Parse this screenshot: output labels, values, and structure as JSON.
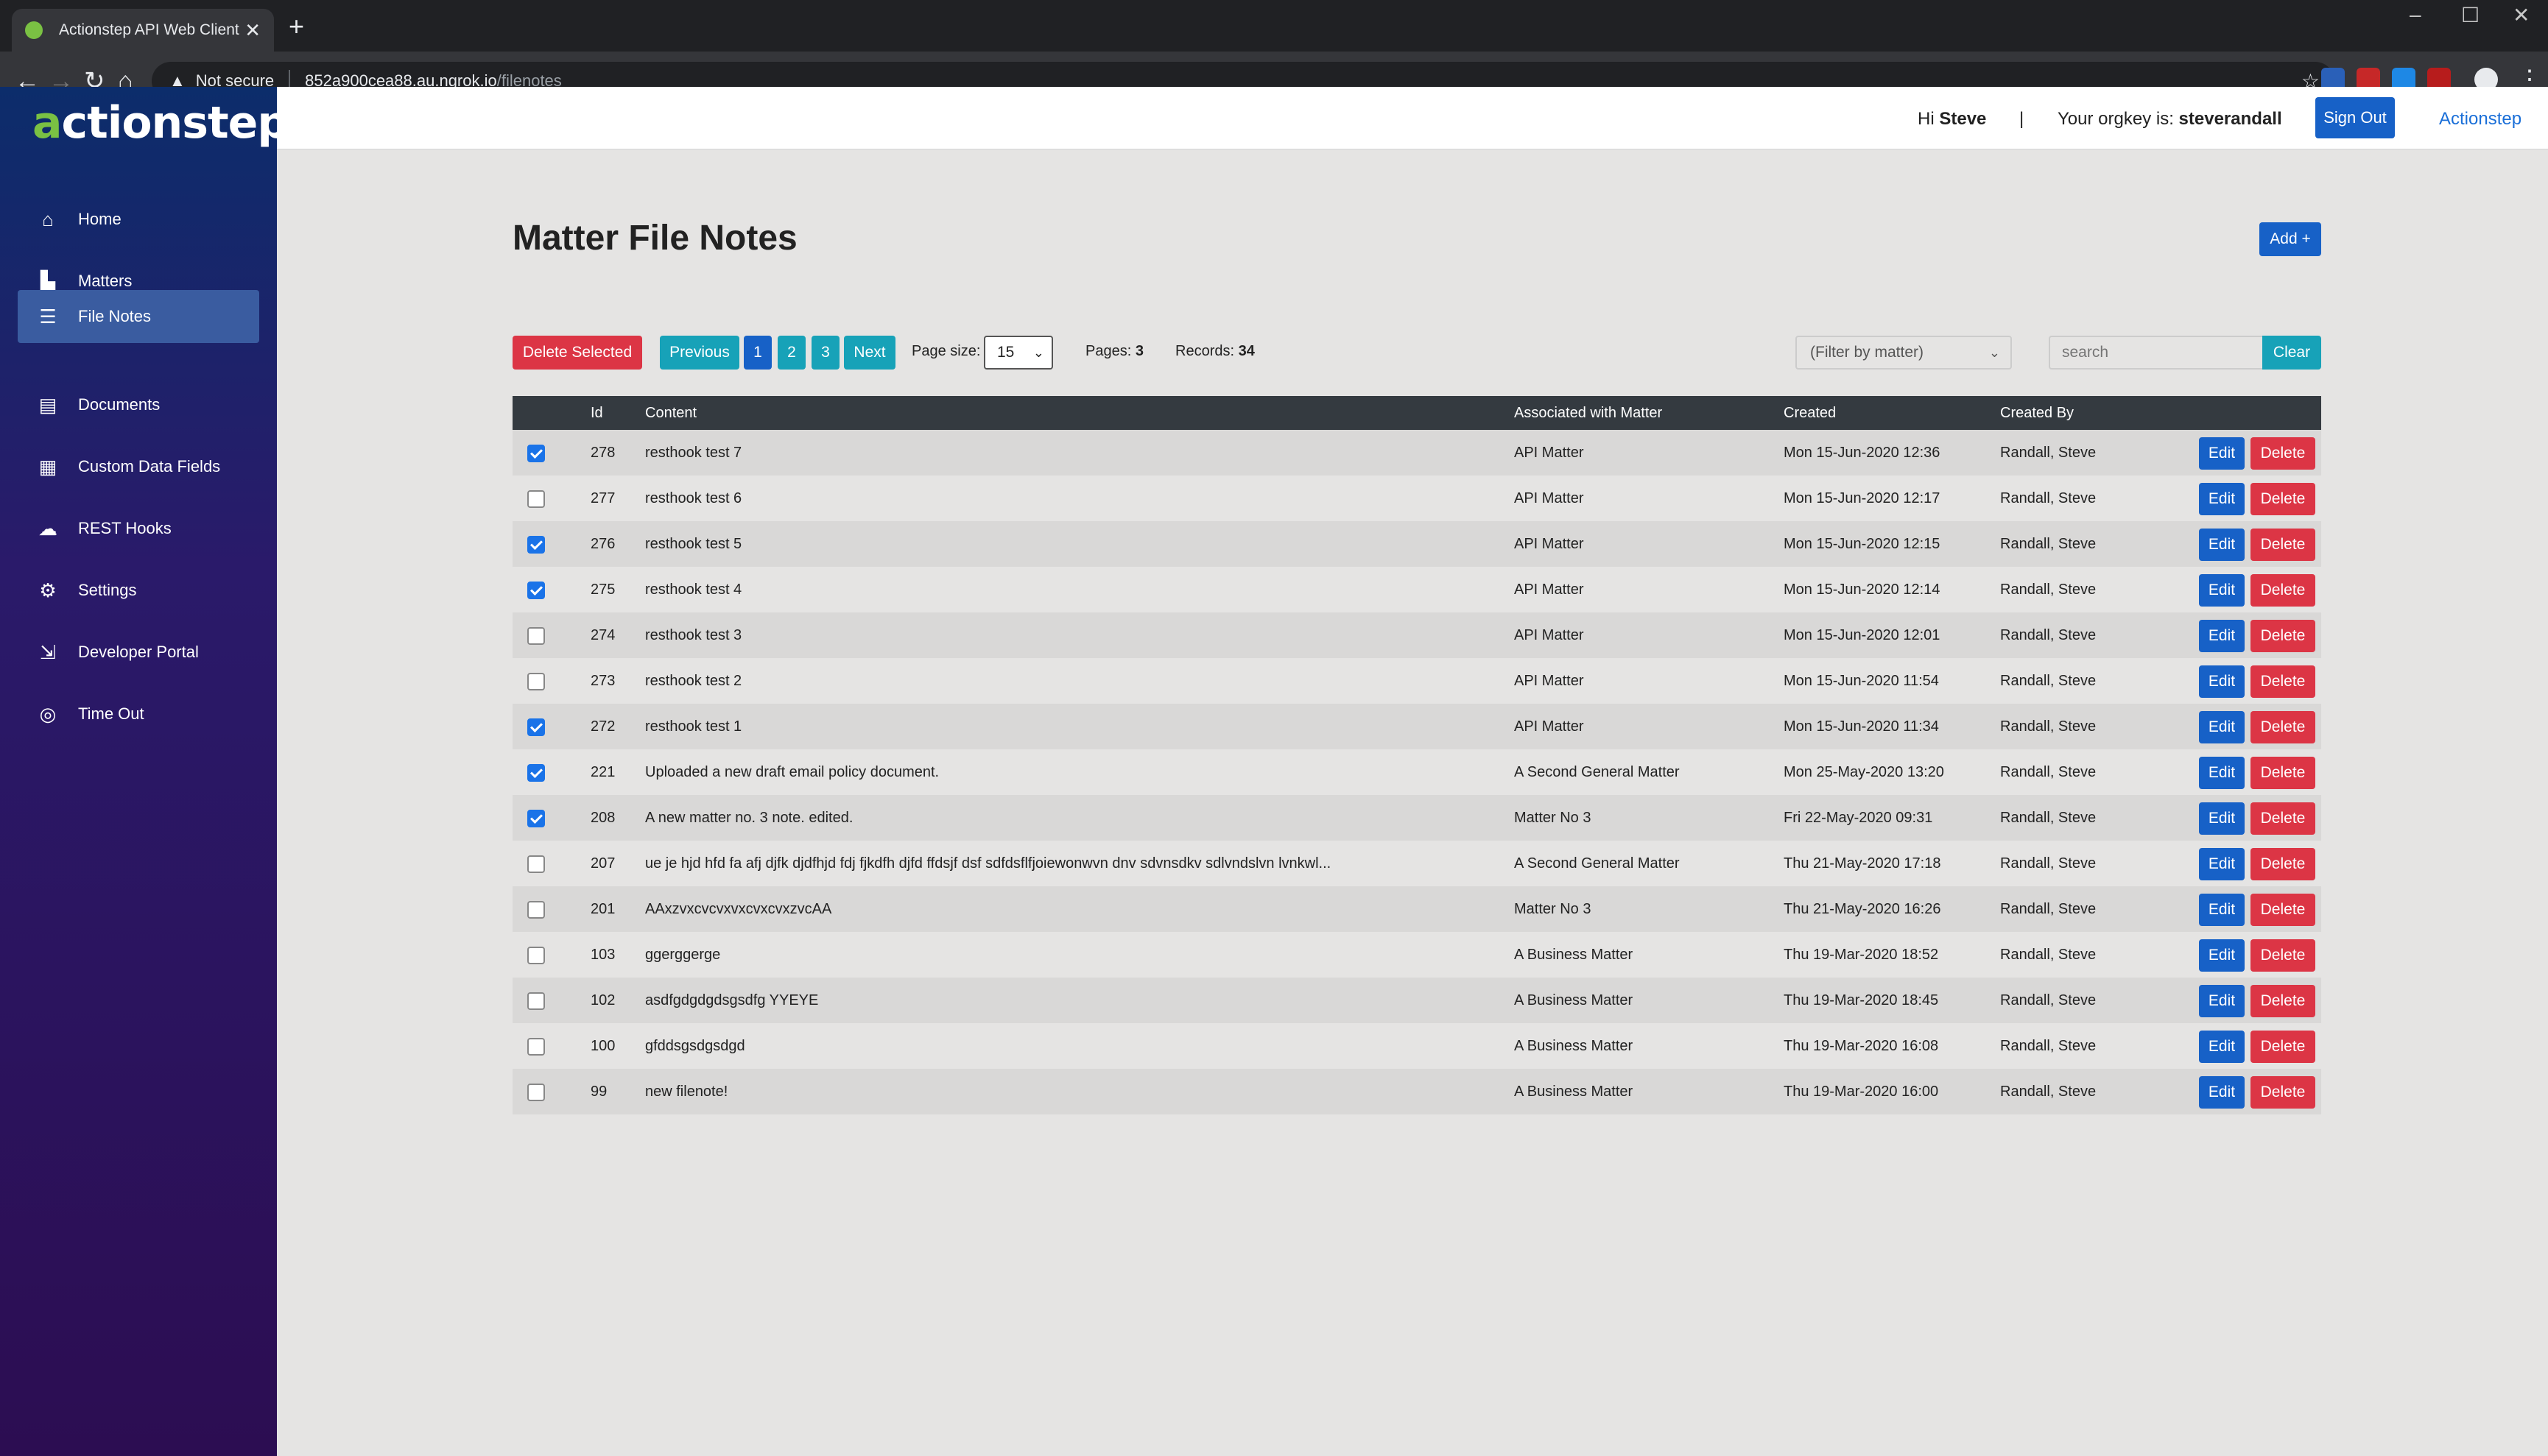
{
  "browser": {
    "tab_title": "Actionstep API Web Client",
    "tab_close": "✕",
    "new_tab": "+",
    "security_warning": "Not secure",
    "url_host": "852a900cea88.au.ngrok.io",
    "url_path": "/filenotes"
  },
  "sidebar": {
    "logo_prefix": "a",
    "logo_rest": "ctionstep",
    "items": [
      {
        "label": "Home",
        "icon": "⌂"
      },
      {
        "label": "Matters",
        "icon": "▙"
      },
      {
        "label": "File Notes",
        "icon": "☰",
        "active": true
      },
      {
        "label": "Documents",
        "icon": "▤"
      },
      {
        "label": "Custom Data Fields",
        "icon": "▦"
      },
      {
        "label": "REST Hooks",
        "icon": "☁"
      },
      {
        "label": "Settings",
        "icon": "⚙"
      },
      {
        "label": "Developer Portal",
        "icon": "⇲"
      },
      {
        "label": "Time Out",
        "icon": "◎"
      }
    ]
  },
  "header": {
    "greeting": "Hi",
    "user": "Steve",
    "divider": "|",
    "orgkey_label": "Your orgkey is:",
    "orgkey": "steverandall",
    "signout_label": "Sign Out",
    "link_label": "Actionstep"
  },
  "page": {
    "title": "Matter File Notes",
    "add_label": "Add +"
  },
  "toolbar": {
    "delete_selected": "Delete Selected",
    "previous": "Previous",
    "pages": [
      "1",
      "2",
      "3"
    ],
    "current_page": "1",
    "next": "Next",
    "page_size_label": "Page size:",
    "page_size": "15",
    "pages_label": "Pages:",
    "pages_count": "3",
    "records_label": "Records:",
    "records_count": "34",
    "filter_placeholder": "(Filter by matter)",
    "search_placeholder": "search",
    "clear_label": "Clear"
  },
  "table": {
    "headers": [
      "Id",
      "Content",
      "Associated with Matter",
      "Created",
      "Created By"
    ],
    "edit_label": "Edit",
    "delete_label": "Delete",
    "rows": [
      {
        "checked": true,
        "id": "278",
        "content": "resthook test 7",
        "matter": "API Matter",
        "created": "Mon 15-Jun-2020 12:36",
        "by": "Randall, Steve"
      },
      {
        "checked": false,
        "id": "277",
        "content": "resthook test 6",
        "matter": "API Matter",
        "created": "Mon 15-Jun-2020 12:17",
        "by": "Randall, Steve"
      },
      {
        "checked": true,
        "id": "276",
        "content": "resthook test 5",
        "matter": "API Matter",
        "created": "Mon 15-Jun-2020 12:15",
        "by": "Randall, Steve"
      },
      {
        "checked": true,
        "id": "275",
        "content": "resthook test 4",
        "matter": "API Matter",
        "created": "Mon 15-Jun-2020 12:14",
        "by": "Randall, Steve"
      },
      {
        "checked": false,
        "id": "274",
        "content": "resthook test 3",
        "matter": "API Matter",
        "created": "Mon 15-Jun-2020 12:01",
        "by": "Randall, Steve"
      },
      {
        "checked": false,
        "id": "273",
        "content": "resthook test 2",
        "matter": "API Matter",
        "created": "Mon 15-Jun-2020 11:54",
        "by": "Randall, Steve"
      },
      {
        "checked": true,
        "id": "272",
        "content": "resthook test 1",
        "matter": "API Matter",
        "created": "Mon 15-Jun-2020 11:34",
        "by": "Randall, Steve"
      },
      {
        "checked": true,
        "id": "221",
        "content": "Uploaded a new draft email policy document.",
        "matter": "A Second General Matter",
        "created": "Mon 25-May-2020 13:20",
        "by": "Randall, Steve"
      },
      {
        "checked": true,
        "id": "208",
        "content": "A new matter no. 3 note. edited.",
        "matter": "Matter No 3",
        "created": "Fri 22-May-2020 09:31",
        "by": "Randall, Steve"
      },
      {
        "checked": false,
        "id": "207",
        "content": "ue je hjd hfd fa afj djfk djdfhjd fdj fjkdfh djfd ffdsjf dsf sdfdsflfjoiewonwvn dnv sdvnsdkv sdlvndslvn lvnkwl...",
        "matter": "A Second General Matter",
        "created": "Thu 21-May-2020 17:18",
        "by": "Randall, Steve"
      },
      {
        "checked": false,
        "id": "201",
        "content": "AAxzvxcvcvxvxcvxcvxzvcAA",
        "matter": "Matter No 3",
        "created": "Thu 21-May-2020 16:26",
        "by": "Randall, Steve"
      },
      {
        "checked": false,
        "id": "103",
        "content": "ggerggerge",
        "matter": "A Business Matter",
        "created": "Thu 19-Mar-2020 18:52",
        "by": "Randall, Steve"
      },
      {
        "checked": false,
        "id": "102",
        "content": "asdfgdgdgdsgsdfg YYEYE",
        "matter": "A Business Matter",
        "created": "Thu 19-Mar-2020 18:45",
        "by": "Randall, Steve"
      },
      {
        "checked": false,
        "id": "100",
        "content": "gfddsgsdgsdgd",
        "matter": "A Business Matter",
        "created": "Thu 19-Mar-2020 16:08",
        "by": "Randall, Steve"
      },
      {
        "checked": false,
        "id": "99",
        "content": "new filenote!",
        "matter": "A Business Matter",
        "created": "Thu 19-Mar-2020 16:00",
        "by": "Randall, Steve"
      }
    ]
  }
}
